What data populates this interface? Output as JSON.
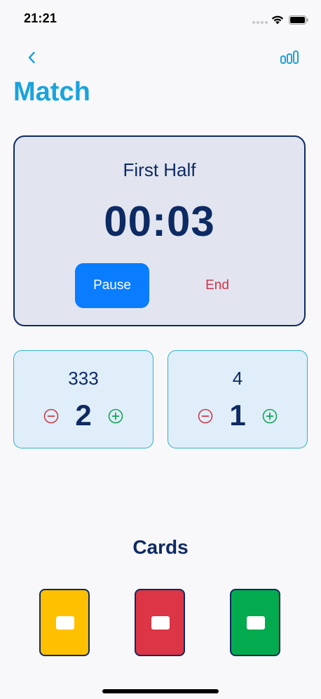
{
  "status_bar": {
    "time": "21:21"
  },
  "nav": {
    "back_icon": "chevron-left-icon",
    "stats_icon": "bar-chart-icon",
    "accent_color": "#1aa3dc"
  },
  "page": {
    "title": "Match"
  },
  "timer": {
    "period": "First Half",
    "elapsed": "00:03",
    "pause_label": "Pause",
    "end_label": "End"
  },
  "teams": [
    {
      "name": "333",
      "score": "2"
    },
    {
      "name": "4",
      "score": "1"
    }
  ],
  "cards": {
    "heading": "Cards",
    "items": [
      {
        "color_name": "yellow",
        "color": "#ffc000"
      },
      {
        "color_name": "red",
        "color": "#dc3545"
      },
      {
        "color_name": "green",
        "color": "#04aa4e"
      }
    ]
  },
  "colors": {
    "navy": "#0d2a63",
    "pause_blue": "#0a7cff",
    "end_red": "#d1334b",
    "minus_red": "#c83a4e",
    "plus_green": "#16a35a"
  }
}
